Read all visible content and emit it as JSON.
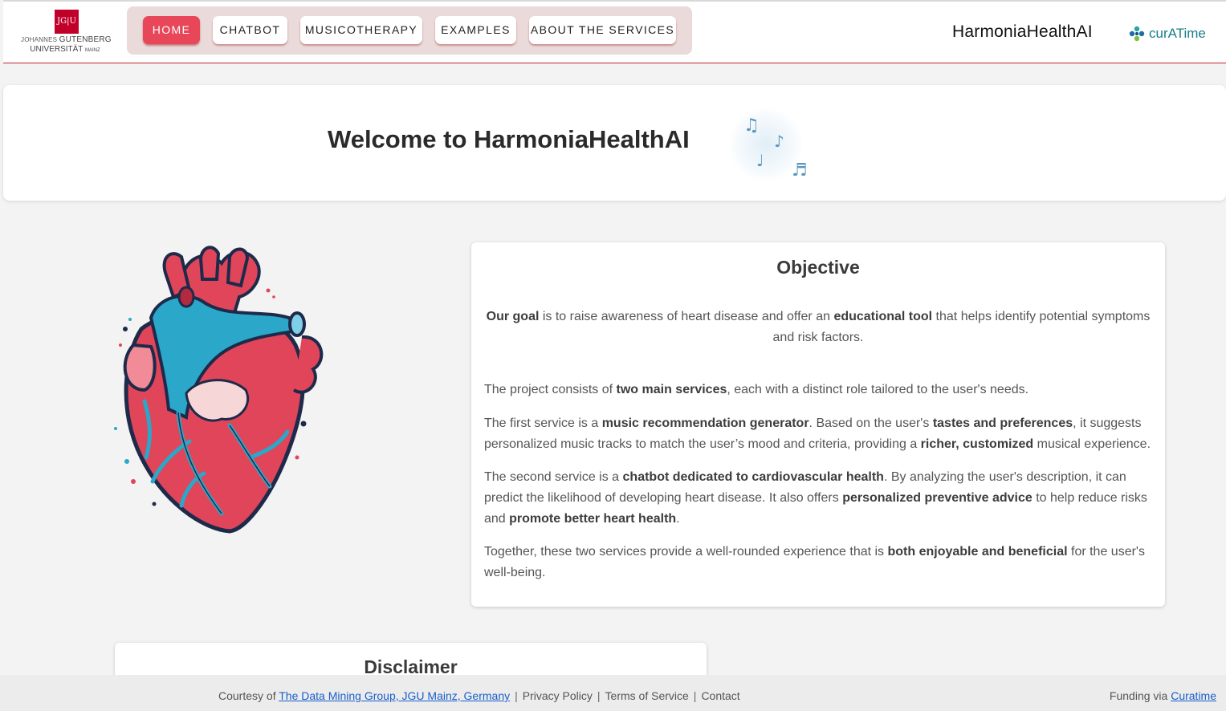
{
  "header": {
    "logo": {
      "mark": "JG|U",
      "line1_small": "JOHANNES",
      "line1": "GUTENBERG",
      "line2": "UNIVERSITÄT",
      "line2_small": "MAINZ"
    },
    "nav": [
      {
        "label": "HOME",
        "active": true
      },
      {
        "label": "CHATBOT",
        "active": false
      },
      {
        "label": "MUSICOTHERAPY",
        "active": false
      },
      {
        "label": "EXAMPLES",
        "active": false
      },
      {
        "label": "ABOUT THE SERVICES",
        "active": false
      }
    ],
    "brand": "HarmoniaHealthAI",
    "partner_logo": "curATime"
  },
  "welcome": {
    "title": "Welcome to HarmoniaHealthAI",
    "decoration_icon": "music-notes-icon"
  },
  "illustration": "anatomical-heart-illustration",
  "objective": {
    "title": "Objective",
    "goal": {
      "b1": "Our goal",
      "t1": " is to raise awareness of heart disease and offer an ",
      "b2": "educational tool",
      "t2": " that helps identify potential symptoms and risk factors."
    },
    "p1": {
      "t1": "The project consists of ",
      "b1": "two main services",
      "t2": ", each with a distinct role tailored to the user's needs."
    },
    "p2": {
      "t1": "The first service is a ",
      "b1": "music recommendation generator",
      "t2": ". Based on the user's ",
      "b2": "tastes and preferences",
      "t3": ", it suggests personalized music tracks to match the user’s mood and criteria, providing a ",
      "b3": "richer, customized",
      "t4": " musical experience."
    },
    "p3": {
      "t1": "The second service is a ",
      "b1": "chatbot dedicated to cardiovascular health",
      "t2": ". By analyzing the user's description, it can predict the likelihood of developing heart disease. It also offers ",
      "b2": "personalized preventive advice",
      "t3": " to help reduce risks and ",
      "b3": "promote better heart health",
      "t4": "."
    },
    "p4": {
      "t1": "Together, these two services provide a well-rounded experience that is ",
      "b1": "both enjoyable and beneficial",
      "t2": " for the user's well-being."
    }
  },
  "disclaimer": {
    "title": "Disclaimer"
  },
  "footer": {
    "courtesy_prefix": "Courtesy of ",
    "courtesy_link": "The Data Mining Group, JGU Mainz, Germany",
    "privacy": "Privacy Policy",
    "terms": "Terms of Service",
    "contact": "Contact",
    "separator": "|",
    "funding_prefix": "Funding via ",
    "funding_link": "Curatime"
  },
  "colors": {
    "accent": "#e8475a",
    "nav_background": "#eadada",
    "header_rule": "#c0272d",
    "link": "#1a5fcc",
    "partner_teal": "#16808a"
  }
}
